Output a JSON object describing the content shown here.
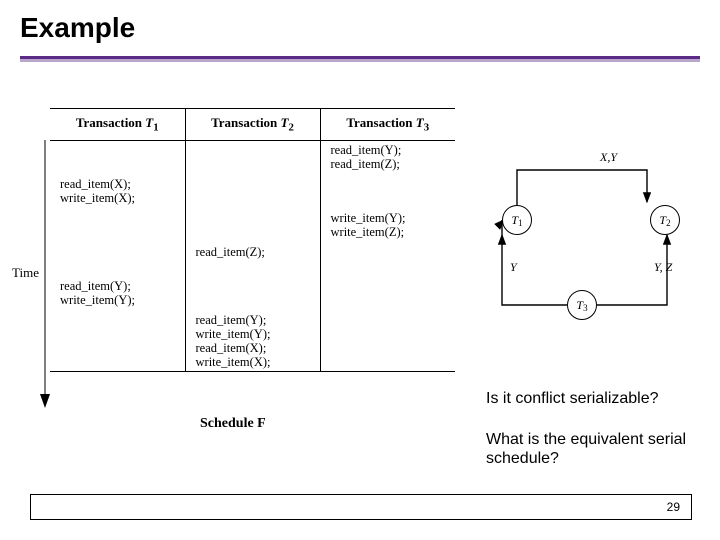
{
  "title": "Example",
  "time_label": "Time",
  "schedule": {
    "headers": {
      "t1_prefix": "Transaction ",
      "t1_name": "T",
      "t1_sub": "1",
      "t2_prefix": "Transaction ",
      "t2_name": "T",
      "t2_sub": "2",
      "t3_prefix": "Transaction ",
      "t3_name": "T",
      "t3_sub": "3"
    },
    "rows": [
      {
        "t1": "",
        "t2": "",
        "t3": "read_item(Y);\nread_item(Z);"
      },
      {
        "t1": "read_item(X);\nwrite_item(X);",
        "t2": "",
        "t3": ""
      },
      {
        "t1": "",
        "t2": "",
        "t3": "write_item(Y);\nwrite_item(Z);"
      },
      {
        "t1": "",
        "t2": "read_item(Z);",
        "t3": ""
      },
      {
        "t1": "read_item(Y);\nwrite_item(Y);",
        "t2": "",
        "t3": ""
      },
      {
        "t1": "",
        "t2": "read_item(Y);\nwrite_item(Y);\nread_item(X);\nwrite_item(X);",
        "t3": ""
      }
    ],
    "caption": "Schedule F"
  },
  "graph": {
    "nodes": {
      "n1": "1",
      "n2": "2",
      "n3": "3",
      "letter": "T"
    },
    "edges": {
      "e_t1_t2": "X,Y",
      "e_t3_t1": "Y",
      "e_t3_t2": "Y, Z"
    }
  },
  "questions": {
    "q1": "Is it conflict serializable?",
    "q2": "What is the equivalent serial schedule?"
  },
  "page_number": "29"
}
